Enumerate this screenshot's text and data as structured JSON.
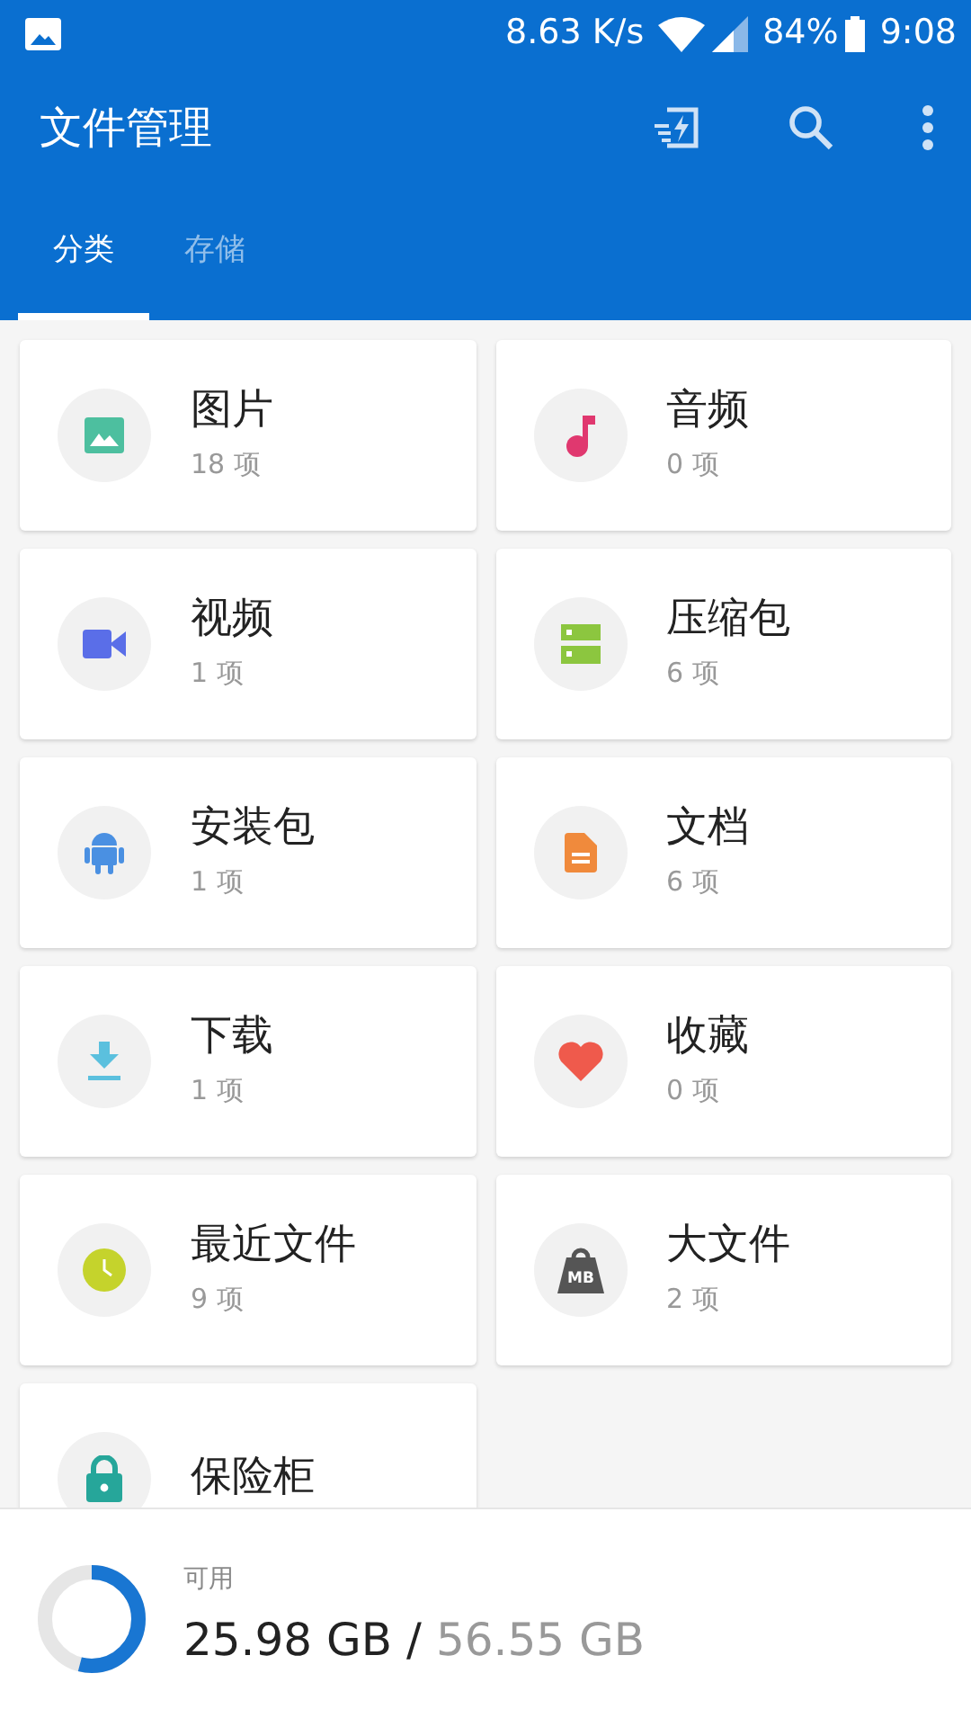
{
  "status_bar": {
    "speed": "8.63 K/s",
    "battery": "84%",
    "time": "9:08"
  },
  "app_bar": {
    "title": "文件管理"
  },
  "tabs": [
    {
      "label": "分类",
      "selected": true
    },
    {
      "label": "存储",
      "selected": false
    }
  ],
  "categories": [
    {
      "kind": "image",
      "name": "图片",
      "count": "18 项"
    },
    {
      "kind": "music",
      "name": "音频",
      "count": "0 项"
    },
    {
      "kind": "video",
      "name": "视频",
      "count": "1 项"
    },
    {
      "kind": "archive",
      "name": "压缩包",
      "count": "6 项"
    },
    {
      "kind": "android",
      "name": "安装包",
      "count": "1 项"
    },
    {
      "kind": "document",
      "name": "文档",
      "count": "6 项"
    },
    {
      "kind": "download",
      "name": "下载",
      "count": "1 项"
    },
    {
      "kind": "favorite",
      "name": "收藏",
      "count": "0 项"
    },
    {
      "kind": "recent",
      "name": "最近文件",
      "count": "9 项"
    },
    {
      "kind": "large",
      "name": "大文件",
      "count": "2 项",
      "icon_label": "MB"
    },
    {
      "kind": "safe",
      "name": "保险柜"
    }
  ],
  "storage": {
    "label": "可用",
    "free": "25.98 GB",
    "separator": "/",
    "total": "56.55 GB",
    "level": 0.54
  }
}
